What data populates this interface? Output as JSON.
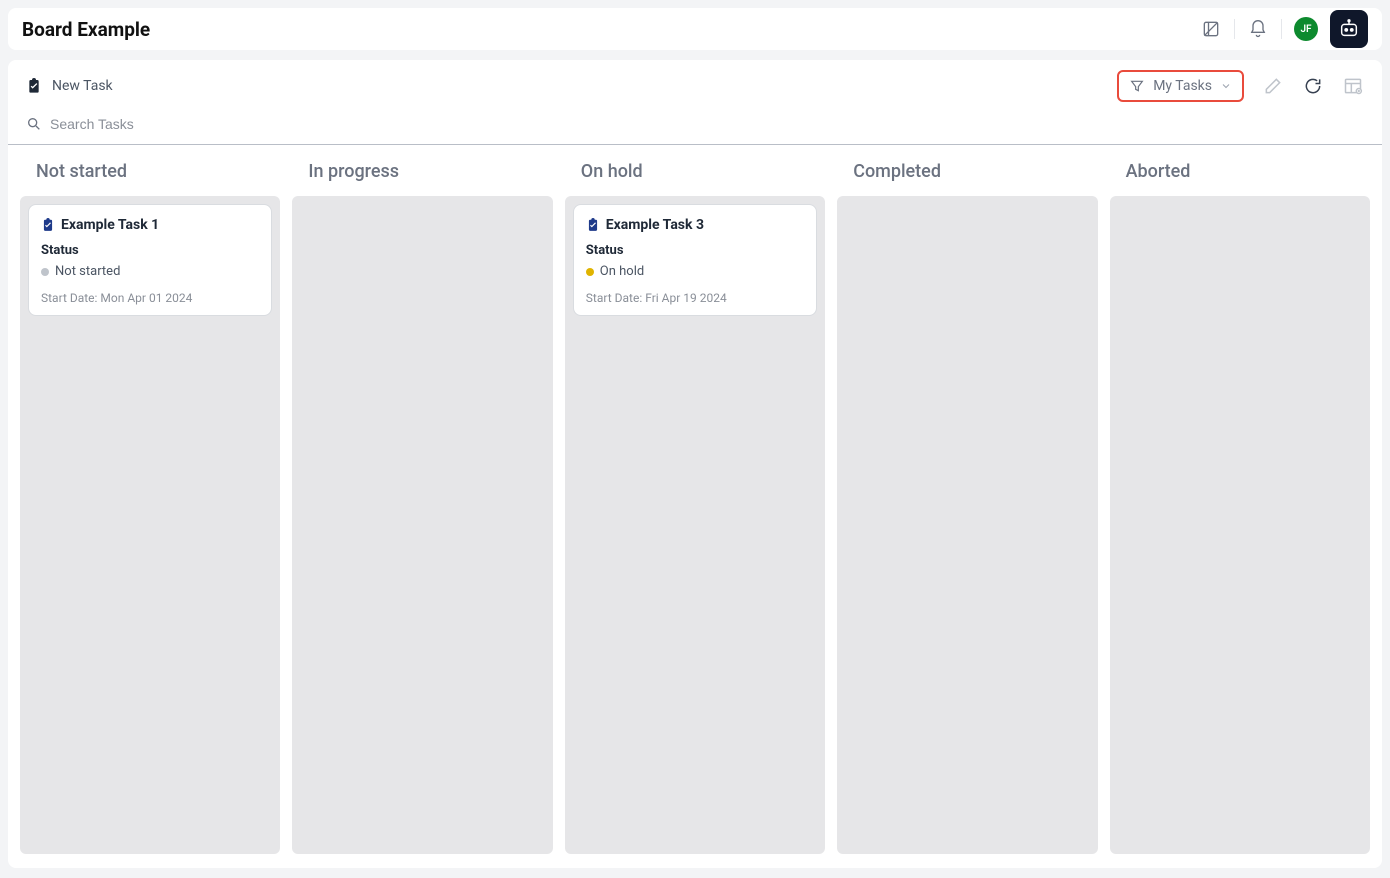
{
  "header": {
    "title": "Board Example",
    "avatar_initials": "JF"
  },
  "toolbar": {
    "new_task_label": "New Task",
    "filter_label": "My Tasks",
    "search_placeholder": "Search Tasks"
  },
  "columns": [
    {
      "title": "Not started"
    },
    {
      "title": "In progress"
    },
    {
      "title": "On hold"
    },
    {
      "title": "Completed"
    },
    {
      "title": "Aborted"
    }
  ],
  "cards": {
    "col0": {
      "title": "Example Task 1",
      "status_label": "Status",
      "status_value": "Not started",
      "start_date": "Start Date: Mon Apr 01 2024"
    },
    "col2": {
      "title": "Example Task 3",
      "status_label": "Status",
      "status_value": "On hold",
      "start_date": "Start Date: Fri Apr 19 2024"
    }
  }
}
